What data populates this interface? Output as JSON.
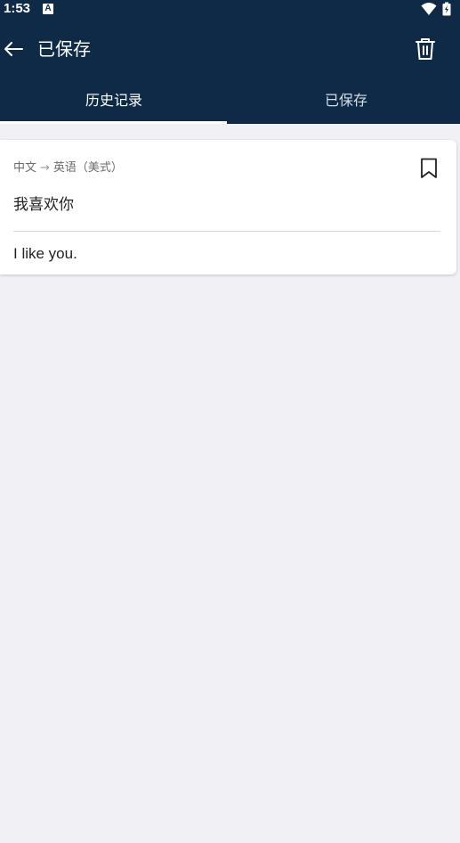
{
  "status_bar": {
    "time": "1:53",
    "notification_icon": "a-icon",
    "wifi_icon": "wifi-icon",
    "battery_icon": "battery-charging-icon"
  },
  "app_bar": {
    "title": "已保存",
    "back_icon": "arrow-left-icon",
    "delete_icon": "trash-icon"
  },
  "tabs": [
    {
      "label": "历史记录",
      "selected": true
    },
    {
      "label": "已保存",
      "selected": false
    }
  ],
  "entries": [
    {
      "source_lang": "中文",
      "arrow": "→",
      "target_lang": "英语（美式）",
      "source_text": "我喜欢你",
      "translated_text": "I like you.",
      "bookmark_icon": "bookmark-outline-icon"
    }
  ],
  "colors": {
    "header_bg": "#0e2a47",
    "page_bg": "#f0f0f5",
    "card_bg": "#ffffff"
  }
}
